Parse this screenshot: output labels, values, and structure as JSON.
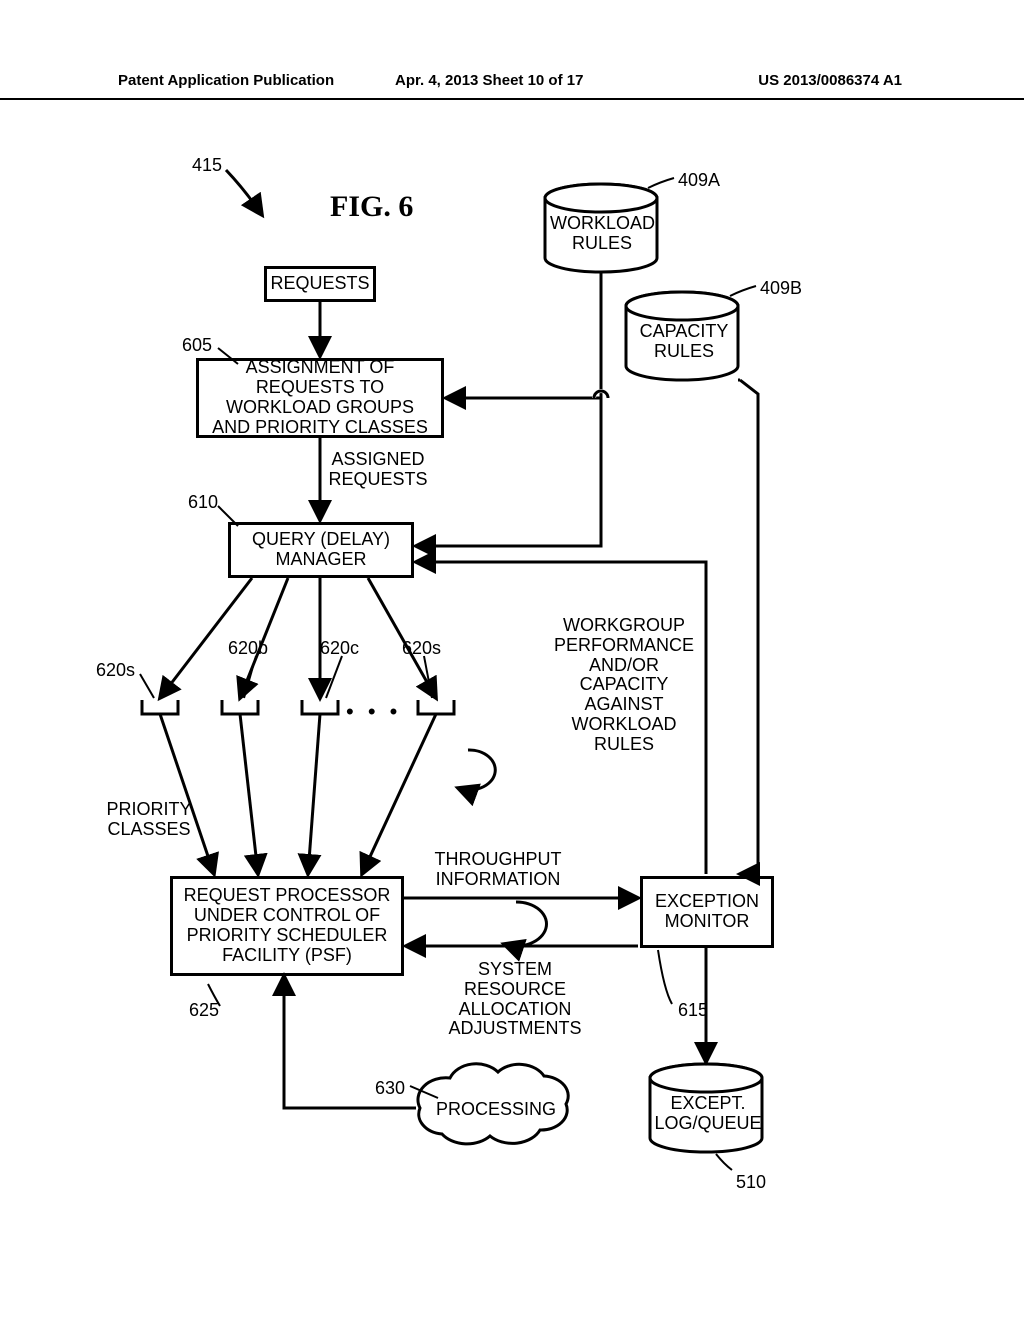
{
  "header": {
    "left": "Patent Application Publication",
    "center": "Apr. 4, 2013  Sheet 10 of 17",
    "right": "US 2013/0086374 A1"
  },
  "figure": {
    "title": "FIG. 6",
    "ref_415": "415",
    "ref_409A": "409A",
    "ref_409B": "409B",
    "ref_605": "605",
    "ref_610": "610",
    "ref_615": "615",
    "ref_620b": "620b",
    "ref_620c": "620c",
    "ref_620s_left": "620s",
    "ref_620s_right": "620s",
    "ref_625": "625",
    "ref_630": "630",
    "ref_510": "510",
    "labels": {
      "requests": "REQUESTS",
      "assignment": "ASSIGNMENT OF REQUESTS TO WORKLOAD GROUPS AND PRIORITY CLASSES",
      "assigned_requests": "ASSIGNED REQUESTS",
      "query_manager": "QUERY (DELAY) MANAGER",
      "priority_classes": "PRIORITY CLASSES",
      "request_processor": "REQUEST PROCESSOR UNDER CONTROL OF PRIORITY SCHEDULER FACILITY (PSF)",
      "processing": "PROCESSING",
      "workload_rules": "WORKLOAD RULES",
      "capacity_rules": "CAPACITY RULES",
      "workgroup_text": "WORKGROUP PERFORMANCE AND/OR CAPACITY AGAINST WORKLOAD RULES",
      "throughput": "THROUGHPUT INFORMATION",
      "sys_resource": "SYSTEM RESOURCE ALLOCATION ADJUSTMENTS",
      "exception_monitor": "EXCEPTION MONITOR",
      "except_log": "EXCEPT. LOG/QUEUE",
      "ellipsis": "• • •"
    }
  }
}
